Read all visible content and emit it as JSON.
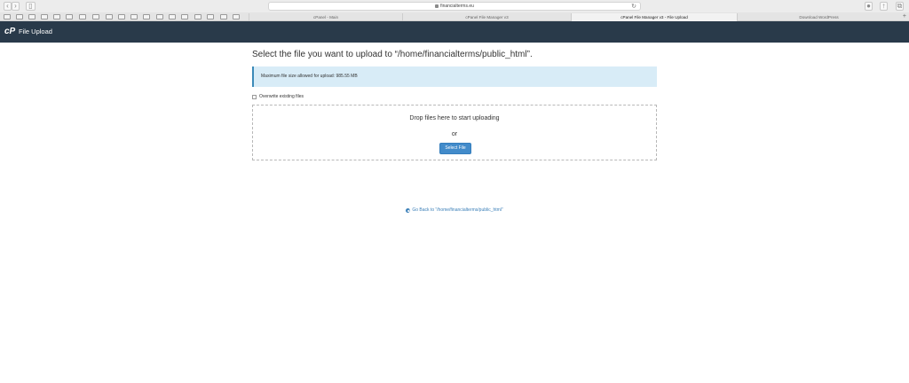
{
  "browser": {
    "url": "financialterms.eu",
    "nav_icons": [
      "back-icon",
      "forward-icon",
      "sidebar-icon"
    ],
    "tabs": [
      {
        "label": "cPanel - Main",
        "active": false
      },
      {
        "label": "cPanel File Manager v3",
        "active": false
      },
      {
        "label": "cPanel File Manager v3 - File Upload",
        "active": true
      },
      {
        "label": "Download WordPress",
        "active": false
      }
    ],
    "add_tab": "+"
  },
  "header": {
    "logo": "cP",
    "title": "File Upload",
    "background": "#293a4a"
  },
  "main": {
    "title": "Select the file you want to upload to “/home/financialterms/public_html”.",
    "info": "Maximum file size allowed for upload: 985.55 MB",
    "overwrite_label": "Overwrite existing files",
    "overwrite_checked": false,
    "drop_text": "Drop files here to start uploading",
    "or_text": "or",
    "select_button": "Select File",
    "go_back": "Go Back to “/home/financialterms/public_html”"
  },
  "colors": {
    "accent": "#428bca",
    "info_background": "#d8ecf7",
    "link": "#3b7fb8"
  }
}
